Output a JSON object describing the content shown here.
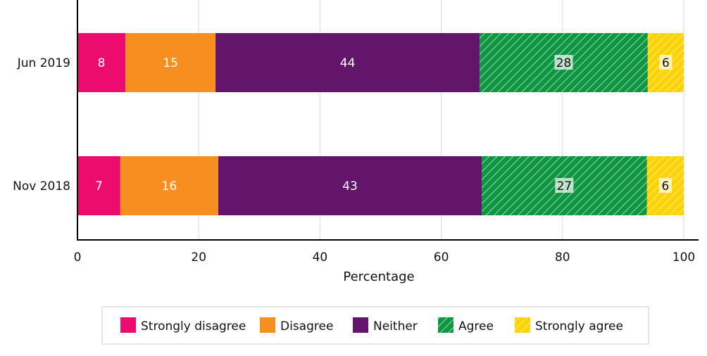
{
  "chart_data": {
    "type": "bar",
    "orientation": "horizontal",
    "stacked": true,
    "title": "",
    "xlabel": "Percentage",
    "ylabel": "",
    "xlim": [
      0,
      100
    ],
    "x_ticks": [
      "0",
      "20",
      "40",
      "60",
      "80",
      "100"
    ],
    "x_tick_values": [
      0,
      20,
      40,
      60,
      80,
      100
    ],
    "grid": "vertical",
    "legend_position": "bottom",
    "categories": [
      "Jun 2019",
      "Nov 2018"
    ],
    "series": [
      {
        "name": "Strongly disagree",
        "color": "#EC0B6E",
        "pattern": "solid",
        "label_color": "#ffffff",
        "values": [
          8,
          7
        ]
      },
      {
        "name": "Disagree",
        "color": "#F68F1F",
        "pattern": "solid",
        "label_color": "#ffffff",
        "values": [
          15,
          16
        ]
      },
      {
        "name": "Neither",
        "color": "#62156B",
        "pattern": "solid",
        "label_color": "#ffffff",
        "values": [
          44,
          43
        ]
      },
      {
        "name": "Agree",
        "color": "#0E9642",
        "pattern": "hatch",
        "label_color": "#111111",
        "values": [
          28,
          27
        ]
      },
      {
        "name": "Strongly agree",
        "color": "#FFD200",
        "pattern": "hatch",
        "label_color": "#111111",
        "values": [
          6,
          6
        ]
      }
    ]
  }
}
